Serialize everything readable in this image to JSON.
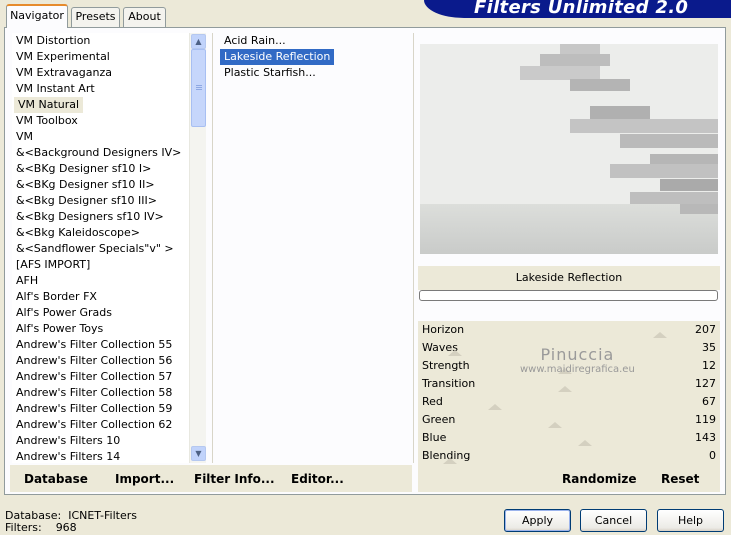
{
  "app": {
    "title": "Filters Unlimited 2.0"
  },
  "tabs": [
    "Navigator",
    "Presets",
    "About"
  ],
  "categories": [
    "VM Distortion",
    "VM Experimental",
    "VM Extravaganza",
    "VM Instant Art",
    "VM Natural",
    "VM Toolbox",
    "VM",
    "&<Background Designers IV>",
    "&<BKg Designer sf10 I>",
    "&<BKg Designer sf10 II>",
    "&<Bkg Designer sf10 III>",
    "&<Bkg Designers sf10 IV>",
    "&<Bkg Kaleidoscope>",
    "&<Sandflower Specials\"v\" >",
    "[AFS IMPORT]",
    "AFH",
    "Alf's Border FX",
    "Alf's Power Grads",
    "Alf's Power Toys",
    "Andrew's Filter Collection 55",
    "Andrew's Filter Collection 56",
    "Andrew's Filter Collection 57",
    "Andrew's Filter Collection 58",
    "Andrew's Filter Collection 59",
    "Andrew's Filter Collection 62",
    "Andrew's Filters 10",
    "Andrew's Filters 14"
  ],
  "selected_category": "VM Natural",
  "filters": [
    "Acid Rain...",
    "Lakeside Reflection",
    "Plastic Starfish..."
  ],
  "selected_filter": "Lakeside Reflection",
  "preview_label": "Lakeside Reflection",
  "params": [
    {
      "name": "Horizon",
      "value": "207"
    },
    {
      "name": "Waves",
      "value": "35"
    },
    {
      "name": "Strength",
      "value": "12"
    },
    {
      "name": "Transition",
      "value": "127"
    },
    {
      "name": "Red",
      "value": "67"
    },
    {
      "name": "Green",
      "value": "119"
    },
    {
      "name": "Blue",
      "value": "143"
    },
    {
      "name": "Blending",
      "value": "0"
    }
  ],
  "left_buttons": {
    "database": "Database",
    "import": "Import...",
    "filter_info": "Filter Info...",
    "editor": "Editor..."
  },
  "right_buttons": {
    "randomize": "Randomize",
    "reset": "Reset"
  },
  "status": {
    "db_label": "Database:",
    "db_value": "ICNET-Filters",
    "filters_label": "Filters:",
    "filters_value": "968"
  },
  "dialog_buttons": {
    "apply": "Apply",
    "cancel": "Cancel",
    "help": "Help"
  },
  "watermark": {
    "line1": "Pinuccia",
    "line2": "www.maidiregrafica.eu"
  },
  "colors": {
    "banner": "#0a1a8c",
    "selection": "#316ac5",
    "tab_accent": "#e68b2c"
  }
}
